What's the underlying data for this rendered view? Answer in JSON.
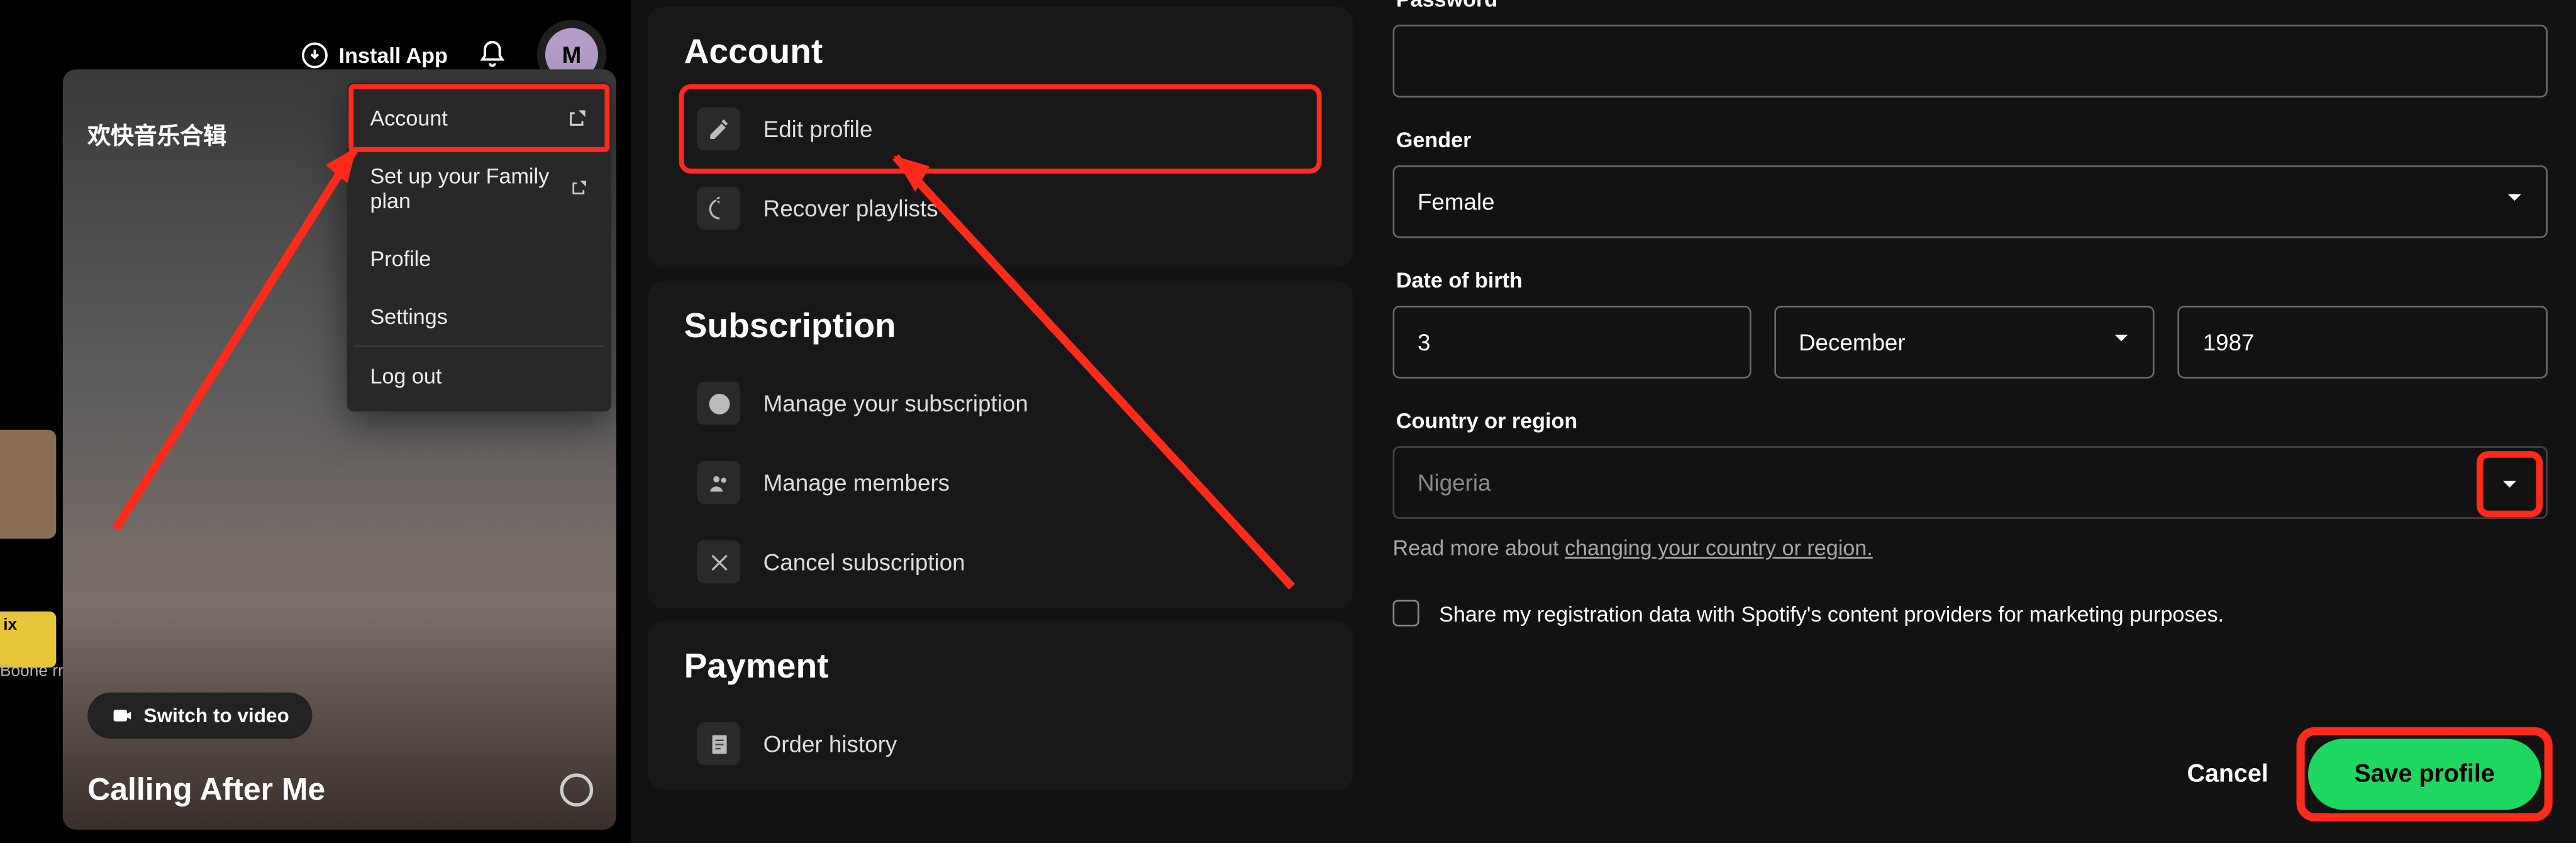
{
  "panel1": {
    "install_label": "Install App",
    "avatar_initial": "M",
    "card_title": "欢快音乐合辑",
    "switch_video": "Switch to video",
    "song_title": "Calling After Me",
    "thumb2_label": "ix",
    "credits": "Boone\nrren",
    "menu": {
      "account": "Account",
      "family": "Set up your Family plan",
      "profile": "Profile",
      "settings": "Settings",
      "logout": "Log out"
    }
  },
  "panel2": {
    "account": {
      "head": "Account",
      "edit_profile": "Edit profile",
      "recover": "Recover playlists"
    },
    "subscription": {
      "head": "Subscription",
      "manage_sub": "Manage your subscription",
      "manage_mem": "Manage members",
      "cancel": "Cancel subscription"
    },
    "payment": {
      "head": "Payment",
      "order_history": "Order history"
    }
  },
  "panel3": {
    "password_label": "Password",
    "password_value": "",
    "gender_label": "Gender",
    "gender_value": "Female",
    "dob_label": "Date of birth",
    "dob_day": "3",
    "dob_month": "December",
    "dob_year": "1987",
    "country_label": "Country or region",
    "country_value": "Nigeria",
    "readmore_prefix": "Read more about ",
    "readmore_link": "changing your country or region.",
    "share_label": "Share my registration data with Spotify's content providers for marketing purposes.",
    "cancel": "Cancel",
    "save": "Save profile"
  }
}
